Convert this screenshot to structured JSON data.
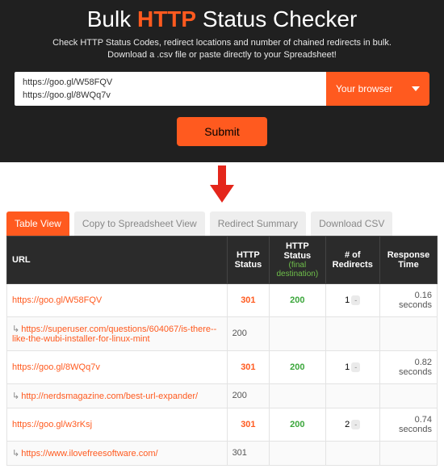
{
  "hero": {
    "title_pre": "Bulk ",
    "title_accent": "HTTP",
    "title_post": " Status Checker",
    "subtitle": "Check HTTP Status Codes, redirect locations and number of chained redirects in bulk. Download a .csv file or paste directly to your Spreadsheet!",
    "urls_value": "https://goo.gl/W58FQV\nhttps://goo.gl/8WQq7v",
    "browser_label": "Your browser",
    "submit_label": "Submit"
  },
  "tabs": {
    "table_view": "Table View",
    "copy_spreadsheet": "Copy to Spreadsheet View",
    "redirect_summary": "Redirect Summary",
    "download_csv": "Download CSV"
  },
  "columns": {
    "url": "URL",
    "status": "HTTP Status",
    "status_final": "HTTP Status",
    "status_final_sub": "(final destination)",
    "redirects": "# of Redirects",
    "response_time": "Response Time"
  },
  "rows": [
    {
      "url": "https://goo.gl/W58FQV",
      "indent": false,
      "status": "301",
      "status_kind": "redir",
      "final": "200",
      "redirects": "1",
      "rt": "0.16 seconds"
    },
    {
      "url": "https://superuser.com/questions/604067/is-there--like-the-wubi-installer-for-linux-mint",
      "indent": true,
      "status": "200",
      "status_kind": "plain",
      "final": "",
      "redirects": "",
      "rt": ""
    },
    {
      "url": "https://goo.gl/8WQq7v",
      "indent": false,
      "status": "301",
      "status_kind": "redir",
      "final": "200",
      "redirects": "1",
      "rt": "0.82 seconds"
    },
    {
      "url": "http://nerdsmagazine.com/best-url-expander/",
      "indent": true,
      "status": "200",
      "status_kind": "plain",
      "final": "",
      "redirects": "",
      "rt": ""
    },
    {
      "url": "https://goo.gl/w3rKsj",
      "indent": false,
      "status": "301",
      "status_kind": "redir",
      "final": "200",
      "redirects": "2",
      "rt": "0.74 seconds"
    },
    {
      "url": "https://www.ilovefreesoftware.com/",
      "indent": true,
      "status": "301",
      "status_kind": "plain",
      "final": "",
      "redirects": "",
      "rt": ""
    }
  ]
}
